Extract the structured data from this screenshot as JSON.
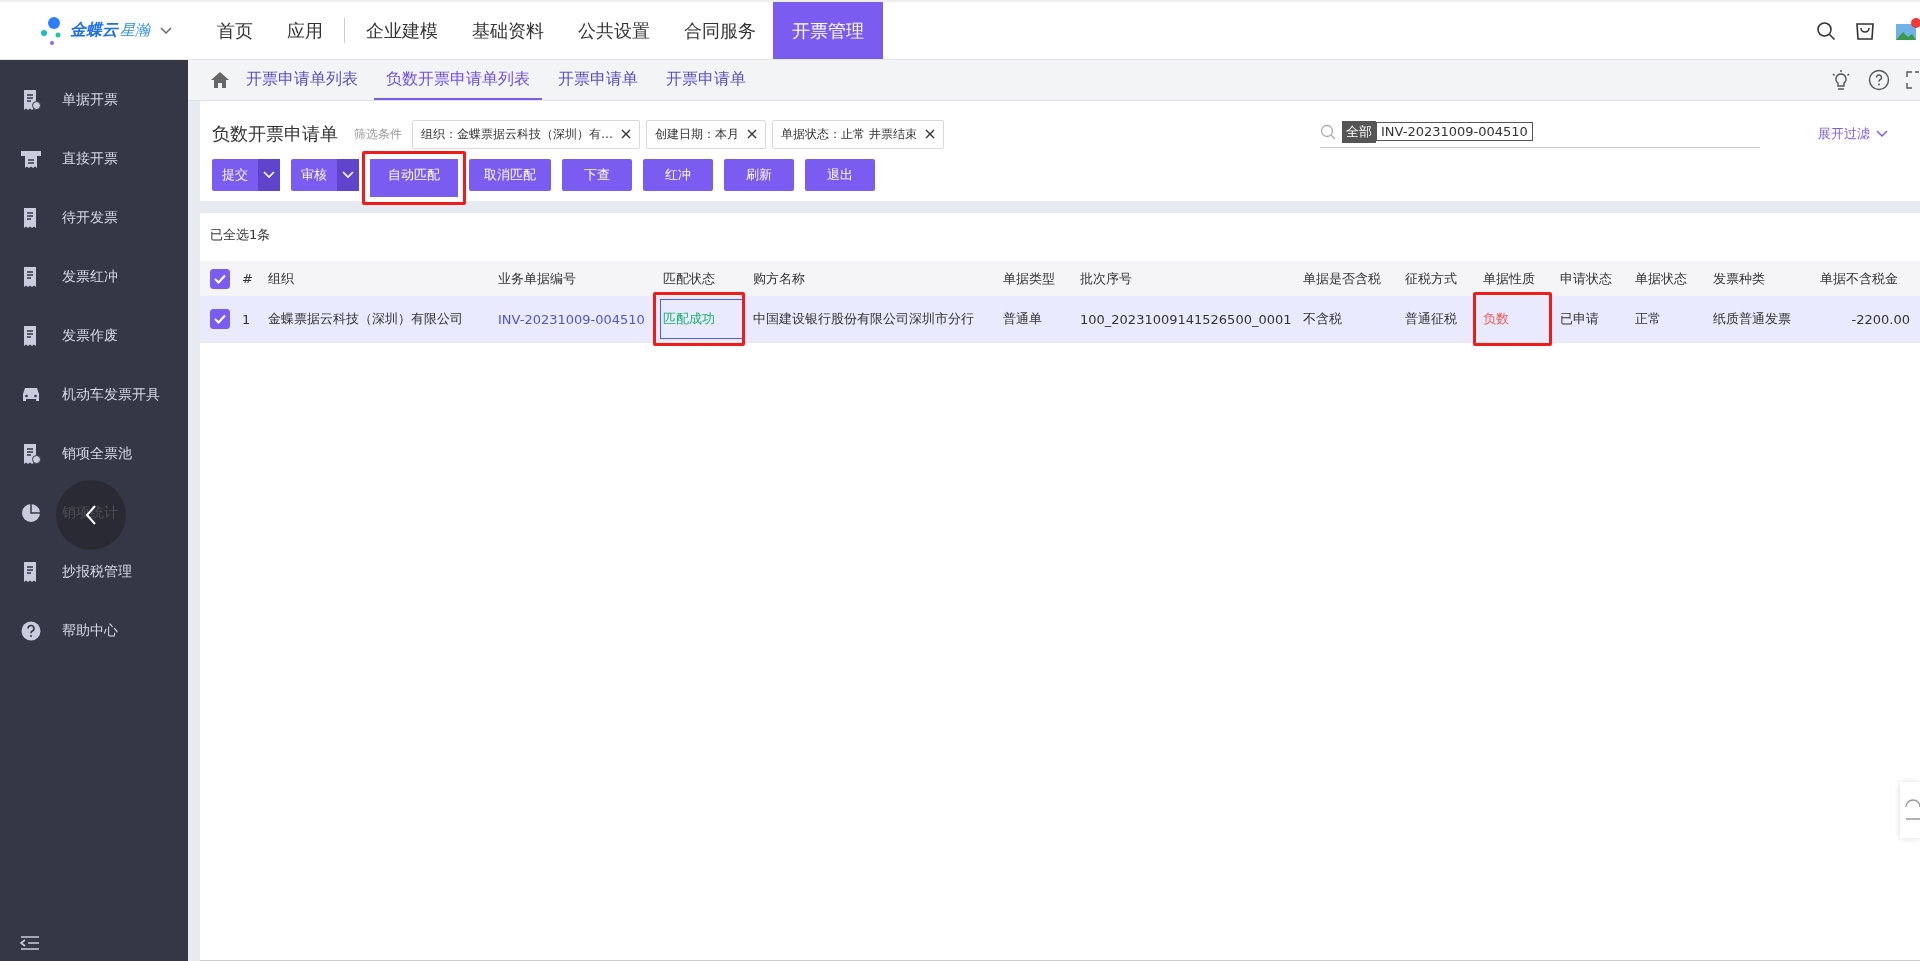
{
  "top_nav": {
    "brand": "金蝶云",
    "brand_suffix": "星瀚",
    "items": [
      {
        "label": "首页",
        "selected": false
      },
      {
        "label": "应用",
        "selected": false
      },
      {
        "label": "企业建模",
        "selected": false
      },
      {
        "label": "基础资料",
        "selected": false
      },
      {
        "label": "公共设置",
        "selected": false
      },
      {
        "label": "合同服务",
        "selected": false
      },
      {
        "label": "开票管理",
        "selected": true
      }
    ]
  },
  "sidebar": {
    "items": [
      {
        "label": "单据开票"
      },
      {
        "label": "直接开票"
      },
      {
        "label": "待开发票"
      },
      {
        "label": "发票红冲"
      },
      {
        "label": "发票作废"
      },
      {
        "label": "机动车发票开具"
      },
      {
        "label": "销项全票池"
      },
      {
        "label": "销项统计"
      },
      {
        "label": "抄报税管理"
      },
      {
        "label": "帮助中心"
      }
    ]
  },
  "page_tabs": [
    {
      "label": "开票申请单列表",
      "selected": false
    },
    {
      "label": "负数开票申请单列表",
      "selected": true
    },
    {
      "label": "开票申请单",
      "selected": false
    },
    {
      "label": "开票申请单",
      "selected": false
    }
  ],
  "header": {
    "title": "负数开票申请单",
    "filter_label": "筛选条件",
    "filters": [
      {
        "text": "组织：金蝶票据云科技（深圳）有…"
      },
      {
        "text": "创建日期：本月"
      },
      {
        "text": "单据状态：止常 井票结束"
      }
    ],
    "search": {
      "scope": "全部",
      "value": "INV-20231009-004510"
    },
    "expand_filter": "展开过滤"
  },
  "toolbar": [
    {
      "label": "提交",
      "kind": "split",
      "highlighted": false
    },
    {
      "label": "审核",
      "kind": "split",
      "highlighted": false
    },
    {
      "label": "自动匹配",
      "kind": "plain",
      "highlighted": true
    },
    {
      "label": "取消匹配",
      "kind": "plain",
      "highlighted": false
    },
    {
      "label": "下查",
      "kind": "plain",
      "highlighted": false
    },
    {
      "label": "红冲",
      "kind": "plain",
      "highlighted": false
    },
    {
      "label": "刷新",
      "kind": "plain",
      "highlighted": false
    },
    {
      "label": "退出",
      "kind": "plain",
      "highlighted": false
    }
  ],
  "selection_summary": "已全选1条",
  "table": {
    "all_checked": true,
    "columns": [
      "#",
      "组织",
      "业务单据编号",
      "匹配状态",
      "购方名称",
      "单据类型",
      "批次序号",
      "单据是否含税",
      "征税方式",
      "单据性质",
      "申请状态",
      "单据状态",
      "发票种类",
      "单据不含税金"
    ],
    "rows": [
      {
        "checked": true,
        "selected": true,
        "cells": [
          {
            "text": "1",
            "kind": "text",
            "highlighted": false,
            "focused": false
          },
          {
            "text": "金蝶票据云科技（深圳）有限公司",
            "kind": "text",
            "highlighted": false,
            "focused": false
          },
          {
            "text": "INV-20231009-004510",
            "kind": "link",
            "highlighted": false,
            "focused": false
          },
          {
            "text": "匹配成功",
            "kind": "success",
            "highlighted": true,
            "focused": true
          },
          {
            "text": "中国建设银行股份有限公司深圳市分行",
            "kind": "text",
            "highlighted": false,
            "focused": false
          },
          {
            "text": "普通单",
            "kind": "text",
            "highlighted": false,
            "focused": false
          },
          {
            "text": "100_20231009141526500_0001",
            "kind": "text",
            "highlighted": false,
            "focused": false
          },
          {
            "text": "不含税",
            "kind": "text",
            "highlighted": false,
            "focused": false
          },
          {
            "text": "普通征税",
            "kind": "text",
            "highlighted": false,
            "focused": false
          },
          {
            "text": "负数",
            "kind": "negative",
            "highlighted": true,
            "focused": false
          },
          {
            "text": "已申请",
            "kind": "text",
            "highlighted": false,
            "focused": false
          },
          {
            "text": "正常",
            "kind": "text",
            "highlighted": false,
            "focused": false
          },
          {
            "text": "纸质普通发票",
            "kind": "text",
            "highlighted": false,
            "focused": false
          },
          {
            "text": "-2200.00",
            "kind": "amount",
            "highlighted": false,
            "focused": false
          }
        ]
      }
    ]
  }
}
